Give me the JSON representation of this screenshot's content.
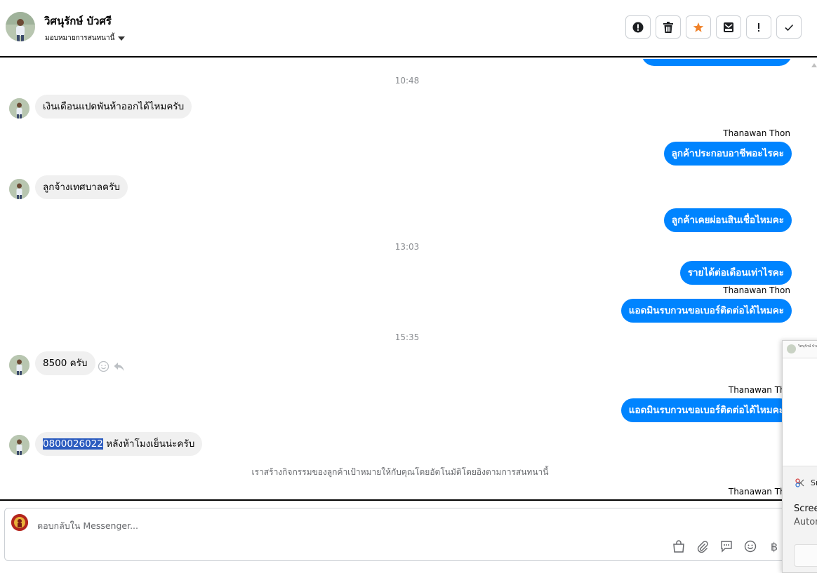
{
  "header": {
    "contact_name": "วิศนุรักษ์ บัวศรี",
    "assign_label": "มอบหมายการสนทนานี้",
    "actions": [
      {
        "name": "spam-alert-button",
        "icon": "alert-circle-icon"
      },
      {
        "name": "delete-button",
        "icon": "trash-icon"
      },
      {
        "name": "star-button",
        "icon": "star-icon",
        "color": "#f0822a"
      },
      {
        "name": "mark-unread-button",
        "icon": "envelope-icon"
      },
      {
        "name": "mark-important-button",
        "icon": "exclamation-icon"
      },
      {
        "name": "mark-done-button",
        "icon": "check-icon"
      }
    ]
  },
  "conversation": {
    "timestamps": [
      "10:48",
      "13:03",
      "15:35"
    ],
    "messages": [
      {
        "from": "contact",
        "text": "เงินเดือนแปดพันห้าออกได้ไหมครับ"
      },
      {
        "from": "page",
        "sender": "Thanawan Thon",
        "text": "ลูกค้าประกอบอาชีพอะไรคะ"
      },
      {
        "from": "contact",
        "text": "ลูกจ้างเทศบาลครับ"
      },
      {
        "from": "page",
        "text": "ลูกค้าเคยผ่อนสินเชื่อไหมคะ"
      },
      {
        "from": "page",
        "text": "รายได้ต่อเดือนเท่าไรคะ"
      },
      {
        "from": "page",
        "sender": "Thanawan Thon",
        "text": "แอดมินรบกวนขอเบอร์ติดต่อได้ไหมคะ"
      },
      {
        "from": "contact",
        "text": "8500 ครับ"
      },
      {
        "from": "page",
        "sender": "Thanawan Tho",
        "text": "แอดมินรบกวนขอเบอร์ติดต่อได้ไหมคะ"
      },
      {
        "from": "contact",
        "highlight": "0800026022",
        "text": " หลังห้าโมงเย็นน่ะครับ"
      }
    ],
    "system_note": "เราสร้างกิจกรรมของลูกค้าเป้าหมายให้กับคุณโดยอัตโนมัติโดยอิงตามการสนทนานี้",
    "last_sender": "Thanawan Tho"
  },
  "composer": {
    "placeholder": "ตอบกลับใน Messenger...",
    "tools": [
      "shop-icon",
      "attachment-icon",
      "saved-reply-icon",
      "emoji-icon",
      "baht-icon"
    ],
    "baht_glyph": "฿"
  },
  "snip_overlay": {
    "app_name": "Sn",
    "title": "Scree",
    "subtitle": "Autor",
    "thumb_text": "วิศนุรักษ์ บัวศ"
  }
}
